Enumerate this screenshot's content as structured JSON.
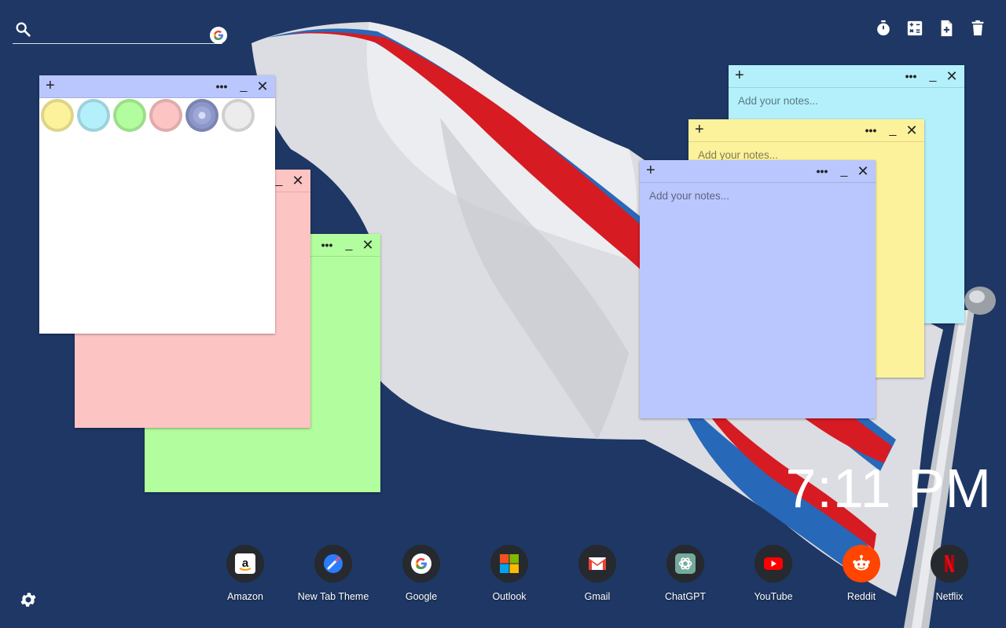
{
  "search": {
    "value": "",
    "placeholder": ""
  },
  "colors": {
    "background": "#1e3764",
    "note_yellow": "#fdf29c",
    "note_cyan": "#b3f0fb",
    "note_green": "#b2fd9e",
    "note_pink": "#fdc4c4",
    "note_blue": "#bac7fe",
    "note_white": "#ffffff"
  },
  "notes": {
    "placeholder": "Add your notes...",
    "plus_label": "+",
    "dots_label": "•••",
    "minimize_label": "_",
    "close_label": "✕"
  },
  "palette": [
    {
      "name": "yellow",
      "fill": "#fdf29c"
    },
    {
      "name": "cyan",
      "fill": "#b3f0fb"
    },
    {
      "name": "green",
      "fill": "#b2fd9e"
    },
    {
      "name": "pink",
      "fill": "#fdc4c4"
    },
    {
      "name": "blue",
      "fill": "#8c97c9"
    },
    {
      "name": "gray",
      "fill": "#ececec"
    }
  ],
  "clock": {
    "time": "7:11 PM"
  },
  "shortcuts": [
    {
      "label": "Amazon",
      "icon": "amazon-icon"
    },
    {
      "label": "New Tab Theme",
      "icon": "new-tab-theme-icon"
    },
    {
      "label": "Google",
      "icon": "google-icon"
    },
    {
      "label": "Outlook",
      "icon": "outlook-icon"
    },
    {
      "label": "Gmail",
      "icon": "gmail-icon"
    },
    {
      "label": "ChatGPT",
      "icon": "chatgpt-icon"
    },
    {
      "label": "YouTube",
      "icon": "youtube-icon"
    },
    {
      "label": "Reddit",
      "icon": "reddit-icon"
    },
    {
      "label": "Netflix",
      "icon": "netflix-icon"
    }
  ],
  "tools": [
    "timer-icon",
    "calculator-icon",
    "new-note-icon",
    "trash-icon"
  ]
}
